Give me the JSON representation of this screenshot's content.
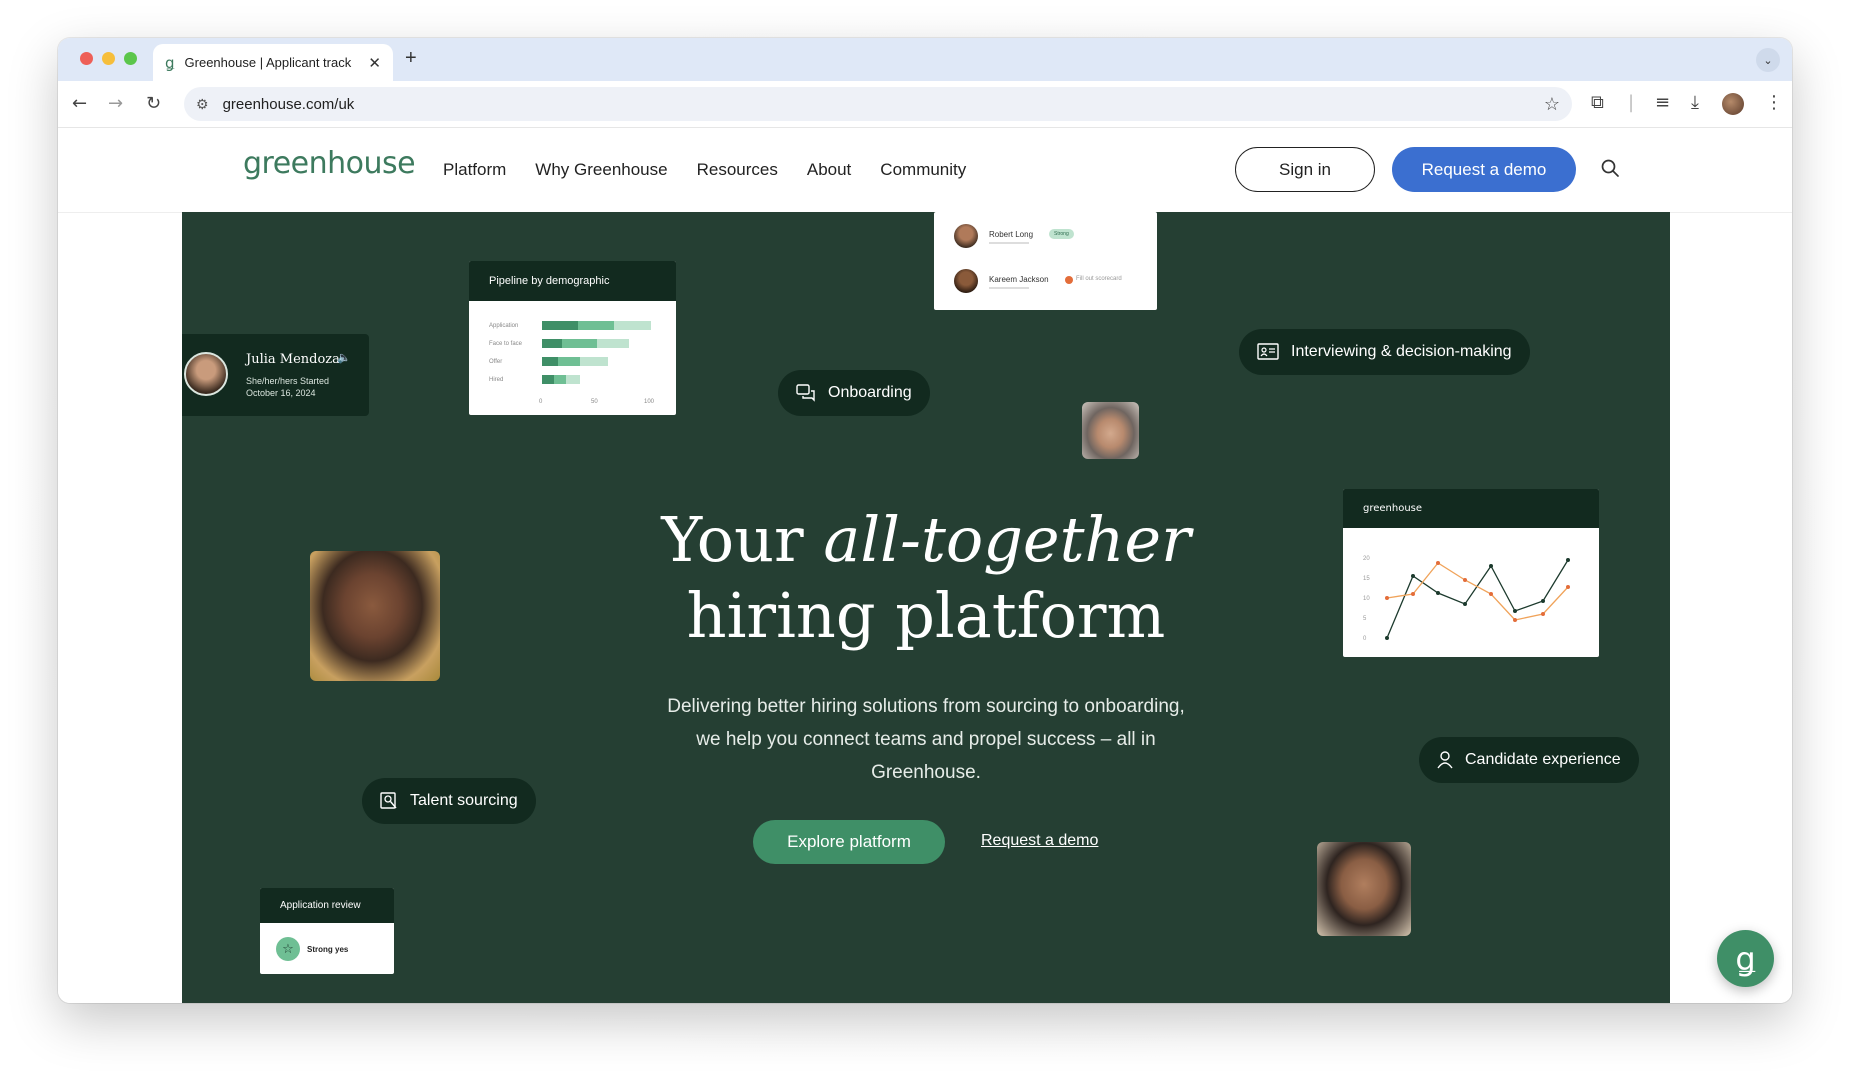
{
  "browser": {
    "tab_title": "Greenhouse | Applicant track",
    "tab_favicon": "ǥ",
    "url": "greenhouse.com/uk",
    "new_tab": "+",
    "tab_close": "✕"
  },
  "nav": {
    "logo": "greenhouse",
    "items": [
      "Platform",
      "Why Greenhouse",
      "Resources",
      "About",
      "Community"
    ],
    "sign_in": "Sign in",
    "request_demo": "Request a demo"
  },
  "hero": {
    "headline_1": "Your",
    "headline_italic": "all-together",
    "headline_2": "hiring platform",
    "subtitle": "Delivering better hiring solutions from sourcing to onboarding, we help you connect teams and propel success – all in Greenhouse.",
    "explore": "Explore platform",
    "demo_link": "Request a demo"
  },
  "pills": {
    "onboarding": "Onboarding",
    "interviewing": "Interviewing & decision-making",
    "talent": "Talent sourcing",
    "candidate": "Candidate experience"
  },
  "julia_card": {
    "name": "Julia Mendoza",
    "meta": "She/her/hers  Started October 16, 2024"
  },
  "pipeline_card": {
    "title": "Pipeline by demographic",
    "rows": [
      "Application",
      "Face to face",
      "Offer",
      "Hired"
    ],
    "ticks": [
      "0",
      "50",
      "100"
    ]
  },
  "scorecard": {
    "person1": "Robert Long",
    "person1_badge": "Strong",
    "person2": "Kareem Jackson",
    "person2_status": "Fill out scorecard"
  },
  "chart_card": {
    "logo": "greenhouse",
    "yticks": [
      "20",
      "15",
      "10",
      "5",
      "0"
    ]
  },
  "app_review": {
    "title": "Application review",
    "result": "Strong yes"
  },
  "colors": {
    "hero_bg": "#253f33",
    "brand_green": "#3d7a5e",
    "button_blue": "#3b6fd0",
    "explore_green": "#3f8f67"
  }
}
